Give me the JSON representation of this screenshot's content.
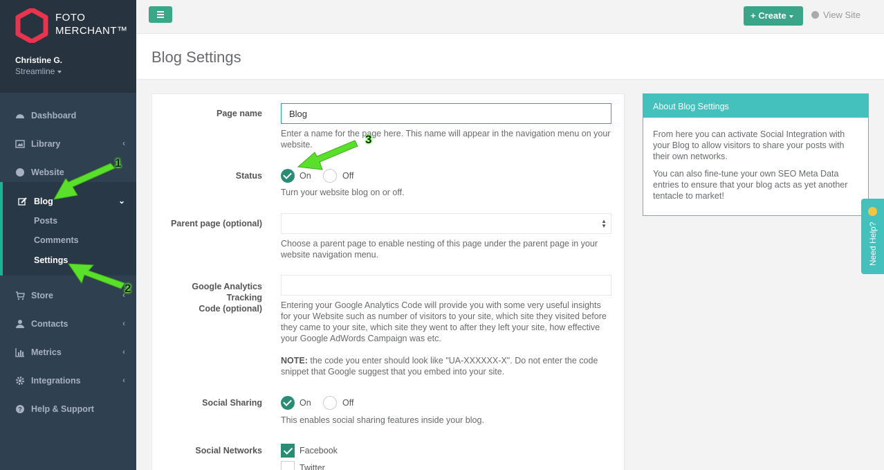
{
  "app": {
    "brand_line1": "FOTO",
    "brand_line2": "MERCHANT™",
    "user_name": "Christine G.",
    "user_plan": "Streamline",
    "accent_color": "#1ab394",
    "teal_color": "#45c1bd"
  },
  "sidebar": {
    "items": [
      {
        "label": "Dashboard",
        "icon": "dashboard-icon"
      },
      {
        "label": "Library",
        "icon": "image-icon"
      },
      {
        "label": "Website",
        "icon": "globe-icon"
      },
      {
        "label": "Blog",
        "icon": "edit-icon"
      },
      {
        "label": "Store",
        "icon": "cart-icon"
      },
      {
        "label": "Contacts",
        "icon": "user-icon"
      },
      {
        "label": "Metrics",
        "icon": "bar-chart-icon"
      },
      {
        "label": "Integrations",
        "icon": "gear-icon"
      },
      {
        "label": "Help & Support",
        "icon": "question-icon"
      }
    ],
    "blog_sub": [
      "Posts",
      "Comments",
      "Settings"
    ]
  },
  "topbar": {
    "create_label": "+ Create",
    "view_site_label": "View Site"
  },
  "page": {
    "title": "Blog Settings"
  },
  "form": {
    "page_name_label": "Page name",
    "page_name_value": "Blog",
    "page_name_help": "Enter a name for the page here. This name will appear in the navigation menu on your website.",
    "status_label": "Status",
    "status_on": "On",
    "status_off": "Off",
    "status_help": "Turn your website blog on or off.",
    "parent_label": "Parent page (optional)",
    "parent_help": "Choose a parent page to enable nesting of this page under the parent page in your website navigation menu.",
    "ga_label_1": "Google Analytics",
    "ga_label_2": "Tracking",
    "ga_label_3": "Code (optional)",
    "ga_help": "Entering your Google Analytics Code will provide you with some very useful insights for your Website such as number of visitors to your site, which site they visited before they came to your site, which site they went to after they left your site, how effective your Google AdWords Campaign was etc.",
    "ga_note_bold": "NOTE:",
    "ga_note": " the code you enter should look like \"UA-XXXXXX-X\". Do not enter the code snippet that Google suggest that you embed into your site.",
    "social_label": "Social Sharing",
    "social_on": "On",
    "social_off": "Off",
    "social_help": "This enables social sharing features inside your blog.",
    "networks_label": "Social Networks",
    "network_1": "Facebook",
    "network_2": "Twitter"
  },
  "about": {
    "title": "About Blog Settings",
    "p1": "From here you can activate Social Integration with your Blog to allow visitors to share your posts with their own networks.",
    "p2": "You can also fine-tune your own SEO Meta Data entries to ensure that your blog acts as yet another tentacle to market!"
  },
  "help_tab": {
    "label": "Need Help?"
  },
  "annotations": [
    "1",
    "2",
    "3"
  ]
}
